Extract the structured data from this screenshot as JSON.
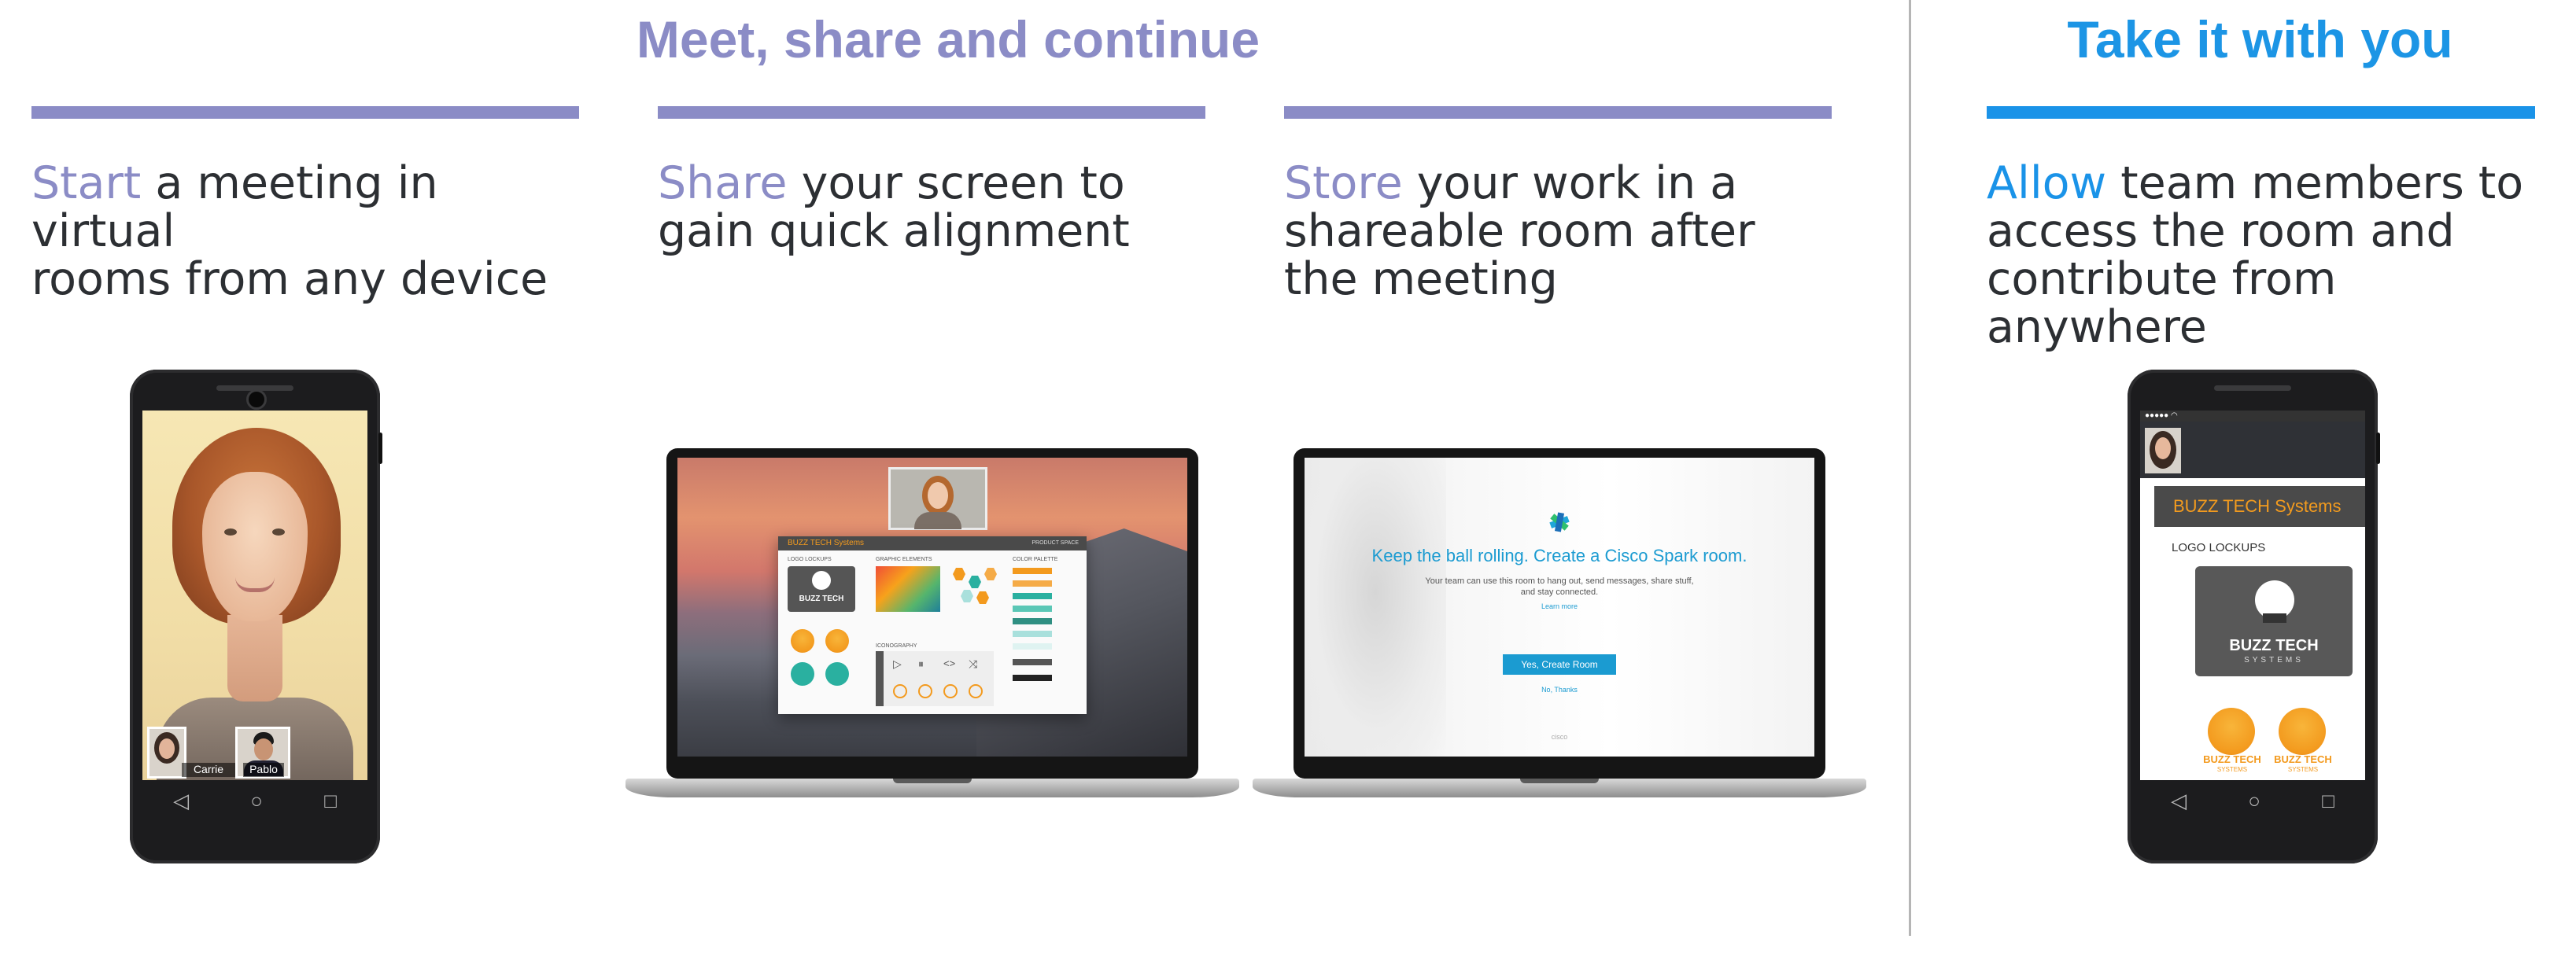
{
  "main_heading": "Meet, share and continue",
  "side_heading": "Take it with you",
  "columns": [
    {
      "keyword": "Start",
      "line1_rest": " a meeting in virtual",
      "line2": "rooms from any device",
      "line3": ""
    },
    {
      "keyword": "Share",
      "line1_rest": " your screen to",
      "line2": "gain quick alignment",
      "line3": ""
    },
    {
      "keyword": "Store",
      "line1_rest": " your work in a",
      "line2": "shareable room after",
      "line3": "the meeting"
    },
    {
      "keyword": "Allow",
      "line1_rest": " team members to",
      "line2": "access the room and",
      "line3": "contribute from anywhere"
    }
  ],
  "phone1": {
    "thumb_left_label": "Carrie",
    "thumb_right_label": "Pablo",
    "nav_icons": [
      "back-icon",
      "home-icon",
      "recents-icon"
    ]
  },
  "laptop1": {
    "app_title": "BUZZ TECH Systems",
    "right_header": "PRODUCT SPACE",
    "sections": [
      "LOGO LOCKUPS",
      "GRAPHIC ELEMENTS",
      "COLOR PALETTE",
      "ICONOGRAPHY"
    ],
    "logo_text": "BUZZ TECH",
    "swatch_colors": [
      "#f39a1e",
      "#f5ab47",
      "#2ab0a0",
      "#5bc7b6",
      "#2f8f82",
      "#a9e0dc",
      "#dff3f1",
      "#555555",
      "#222222"
    ]
  },
  "laptop2": {
    "title": "Keep the ball rolling. Create a Cisco Spark room.",
    "subtitle_line1": "Your team can use this room to hang out, send messages, share stuff,",
    "subtitle_line2": "and stay connected.",
    "learn_more": "Learn more",
    "primary_button": "Yes, Create Room",
    "secondary_link": "No, Thanks",
    "footer_brand": "cisco"
  },
  "phone3": {
    "app_title": "BUZZ TECH Systems",
    "section_label": "LOGO LOCKUPS",
    "logo_text": "BUZZ TECH",
    "logo_subtext": "SYSTEMS",
    "badge_text": "BUZZ TECH",
    "badge_subtext": "SYSTEMS"
  },
  "colors": {
    "purple": "#8b8cc6",
    "blue": "#1a93e8",
    "text": "#2c2f33",
    "orange": "#f39a1e"
  }
}
